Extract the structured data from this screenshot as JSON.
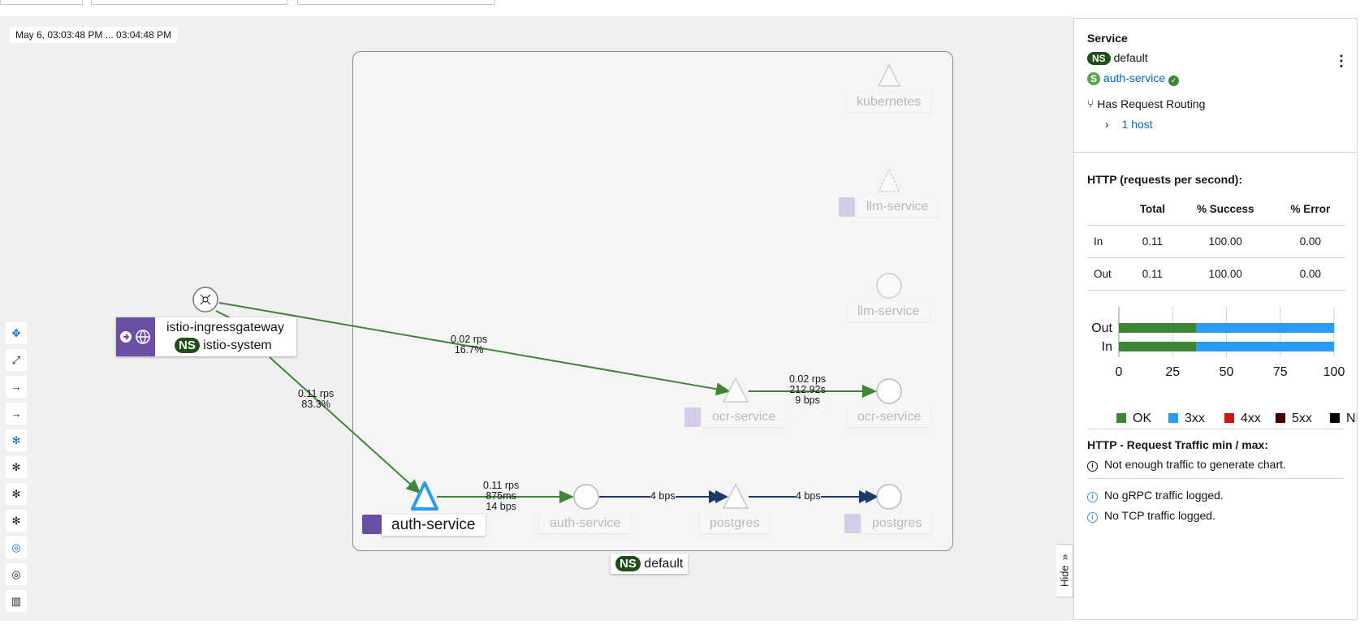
{
  "graph": {
    "timestamp": "May 6, 03:03:48 PM ... 03:04:48 PM",
    "namespace_footer": "default",
    "ns_badge": "NS",
    "nodes": {
      "kubernetes": "kubernetes",
      "llm_service_app": "llm-service",
      "llm_service_workload": "llm-service",
      "ocr_service_app": "ocr-service",
      "ocr_service_workload": "ocr-service",
      "auth_service_app": "auth-service",
      "auth_service_workload": "auth-service",
      "postgres_app": "postgres",
      "postgres_service": "postgres",
      "ingress_title": "istio-ingressgateway",
      "ingress_ns": "istio-system"
    },
    "edges": {
      "ingress_to_ocr": [
        "0.02 rps",
        "16.7%"
      ],
      "ingress_to_auth": [
        "0.11 rps",
        "83.3%"
      ],
      "ocr_to_ocr": [
        "0.02 rps",
        "212.92s",
        "9 bps"
      ],
      "auth_to_auth": [
        "0.11 rps",
        "875ms",
        "14 bps"
      ],
      "auth_to_postgres": [
        "4 bps"
      ],
      "postgres_to_postgres": [
        "4 bps"
      ]
    },
    "colors": {
      "success": "#3e8635",
      "tcp": "#1b3a6b",
      "accent": "#2b9af3"
    },
    "hide_tab": "Hide",
    "toolbar_icons": [
      "move-icon",
      "fit-icon",
      "arrow-icon",
      "arrow-icon",
      "layout-icon",
      "layout-icon",
      "layout-icon",
      "layout-icon",
      "legend-icon",
      "legend-icon",
      "map-icon"
    ]
  },
  "panel": {
    "title": "Service",
    "ns_badge": "NS",
    "namespace": "default",
    "service_badge": "S",
    "service_name": "auth-service",
    "routing": "Has Request Routing",
    "hosts_link": "1 host",
    "http_title": "HTTP (requests per second):",
    "table": {
      "headers": [
        "",
        "Total",
        "% Success",
        "% Error"
      ],
      "rows": [
        [
          "In",
          "0.11",
          "100.00",
          "0.00"
        ],
        [
          "Out",
          "0.11",
          "100.00",
          "0.00"
        ]
      ]
    },
    "traffic_title": "HTTP - Request Traffic min / max:",
    "traffic_note": "Not enough traffic to generate chart.",
    "grpc_note": "No gRPC traffic logged.",
    "tcp_note": "No TCP traffic logged."
  },
  "chart_data": {
    "type": "bar",
    "orientation": "horizontal",
    "stacked": true,
    "categories": [
      "Out",
      "In"
    ],
    "series": [
      {
        "name": "OK",
        "color": "#3e8635",
        "values": [
          36,
          36
        ]
      },
      {
        "name": "3xx",
        "color": "#2b9af3",
        "values": [
          64,
          64
        ]
      },
      {
        "name": "4xx",
        "color": "#c9190b",
        "values": [
          0,
          0
        ]
      },
      {
        "name": "5xx",
        "color": "#470000",
        "values": [
          0,
          0
        ]
      },
      {
        "name": "NR",
        "color": "#000000",
        "values": [
          0,
          0
        ]
      }
    ],
    "xticks": [
      "0",
      "25",
      "50",
      "75",
      "100"
    ],
    "xlim": [
      0,
      100
    ],
    "grid": true,
    "legend": "bottom"
  }
}
